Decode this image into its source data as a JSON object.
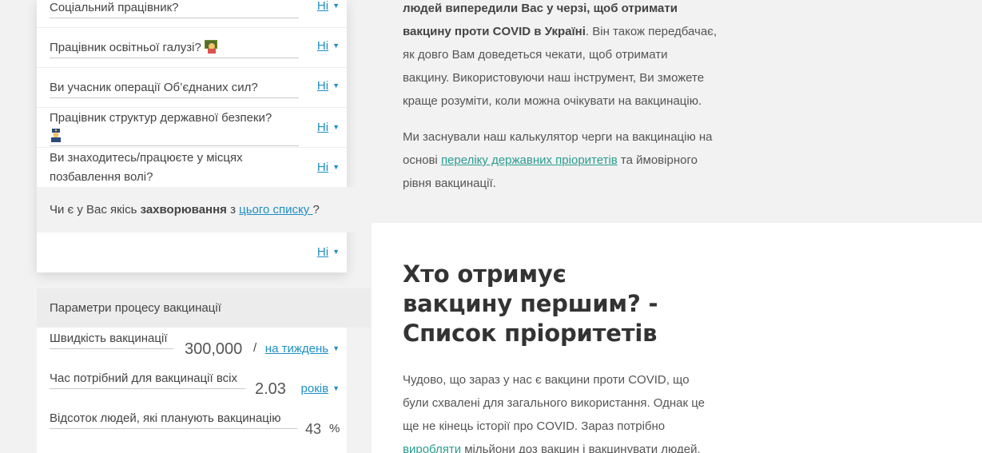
{
  "questions": [
    {
      "label": "Соціальний працівник?",
      "value": "Ні"
    },
    {
      "label": "Працівник освітньої галузі?",
      "value": "Ні",
      "icon": "teacher-emoji-icon"
    },
    {
      "label": "Ви учасник операції Об’єднаних сил?",
      "value": "Ні"
    },
    {
      "label": "Працівник структур державної безпеки?",
      "value": "Ні",
      "icon": "police-officer-emoji-icon"
    },
    {
      "label": "Ви знаходитесь/працюєте у місцях позбавлення волі?",
      "value": "Ні"
    }
  ],
  "disease": {
    "prefix": "Чи є у Вас якісь ",
    "bold": "захворювання",
    "mid": " з ",
    "link": "цього списку ",
    "suffix": "?",
    "value": "Ні"
  },
  "params": {
    "title": "Параметри процесу вакцинації",
    "speed": {
      "label": "Швидкість вакцинації",
      "value": "300,000",
      "slash": "/",
      "unit": "на тиждень"
    },
    "time": {
      "label": "Час потрібний для вакцинації всіх",
      "value": "2.03",
      "unit": "років"
    },
    "percent": {
      "label": "Відсоток людей, які планують вакцинацію",
      "value": "43",
      "unit": "%"
    }
  },
  "article": {
    "p1_bold_a": "людей випередили Вас у черзі, щоб отримати",
    "p1_bold_b": "вакцину проти COVID в Україні",
    "p1_rest_a": ". Він також передбачає,",
    "p1_line3": "як довго Вам доведеться чекати, щоб отримати",
    "p1_line4": "вакцину. Використовуючи наш інструмент, Ви зможете",
    "p1_line5": "краще розуміти, коли можна очікувати на вакцинацію.",
    "p2_line1": "Ми заснували наш калькулятор черги на вакцинацію на",
    "p2_pre": "основі ",
    "p2_link": "переліку державних пріоритетів",
    "p2_post": " та ймовірного",
    "p2_line3": "рівня вакцинації.",
    "heading": "Хто отримує вакцину першим? - Список пріоритетів",
    "p3_line1": "Чудово, що зараз у нас є вакцини проти COVID, що",
    "p3_line2": "були схвалені для загального використання. Однак це",
    "p3_line3": "ще не кінець історії про COVID. Зараз потрібно",
    "p3_link": "виробляти",
    "p3_post": " мільйони доз вакцин і вакцинувати людей."
  },
  "colors": {
    "link_blue": "#1f8fc4",
    "link_green": "#2a9d8f",
    "band_gray": "#f2f2f2"
  }
}
